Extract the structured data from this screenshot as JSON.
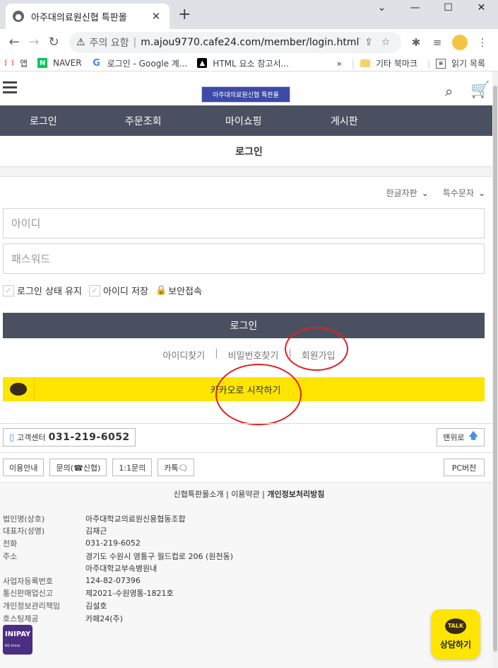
{
  "browser": {
    "tab_title": "아주대의료원신협 특판몰",
    "tab_close": "✕",
    "new_tab": "+",
    "security_label": "주의 요함",
    "url": "m.ajou9770.cafe24.com/member/login.html?...",
    "bookmarks": [
      "앱",
      "NAVER",
      "로그인 - Google 계...",
      "HTML 요소 참고서..."
    ],
    "bookmarks_more": "»",
    "other_bookmarks": "기타 북마크",
    "reading_list": "읽기 목록"
  },
  "site": {
    "logo_text": "아주대의료원신협 특판몰",
    "nav": [
      "로그인",
      "주문조회",
      "마이쇼핑",
      "게시판"
    ],
    "page_title": "로그인"
  },
  "login": {
    "keyboard_korean": "한글자판",
    "keyboard_special": "특수문자",
    "id_placeholder": "아이디",
    "pw_placeholder": "패스워드",
    "keep_login": "로그인 상태 유지",
    "save_id": "아이디 저장",
    "secure_login": "보안접속",
    "login_button": "로그인",
    "find_id": "아이디찾기",
    "find_pw": "비밀번호찾기",
    "join": "회원가입",
    "kakao_button": "카카오로 시작하기"
  },
  "footer": {
    "cs_label": "고객센터",
    "cs_number": "031-219-6052",
    "top_button": "맨위로",
    "buttons": [
      "이용안내",
      "문의(☎신협)",
      "1:1문의",
      "카톡🗨"
    ],
    "pc_button": "PC버전",
    "policy_links": [
      "신협특판몰소개",
      "이용약관",
      "개인정보처리방침"
    ],
    "info": [
      {
        "k": "법인명(상호)",
        "v": "아주대학교의료원신용협동조합"
      },
      {
        "k": "대표자(성명)",
        "v": "김재근"
      },
      {
        "k": "전화",
        "v": "031-219-6052"
      },
      {
        "k": "주소",
        "v": "경기도 수원시 영통구 월드컵로 206 (원천동)"
      },
      {
        "k": "",
        "v": "아주대학교부속병원내"
      },
      {
        "k": "사업자등록번호",
        "v": "124-82-07396"
      },
      {
        "k": "통신판매업신고",
        "v": "제2021-수원영통-1821호"
      },
      {
        "k": "개인정보관리책임",
        "v": "김설호"
      },
      {
        "k": "호스팅제공",
        "v": "카페24(주)"
      }
    ],
    "inipay_logo": "INIPAY",
    "inipay_sub": "KG Inicis",
    "talk_badge": "TALK",
    "talk_label": "상담하기"
  }
}
